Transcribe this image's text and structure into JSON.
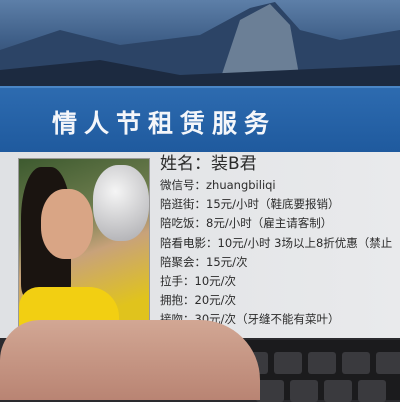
{
  "banner": {
    "title": "情人节租赁服务"
  },
  "profile": {
    "name": "姓名：装B君",
    "rows": [
      "微信号：zhuangbiliqi",
      "陪逛街：15元/小时（鞋底要报销）",
      "陪吃饭：8元/小时（雇主请客制）",
      "陪看电影：10元/小时 3场以上8折优惠（禁止",
      "陪聚会：15元/次",
      "拉手：10元/次",
      "拥抱：20元/次",
      "接吻：30元/次（牙缝不能有菜叶）"
    ]
  },
  "colors": {
    "band": "#1f5a9e",
    "card": "#e4e5e7"
  }
}
